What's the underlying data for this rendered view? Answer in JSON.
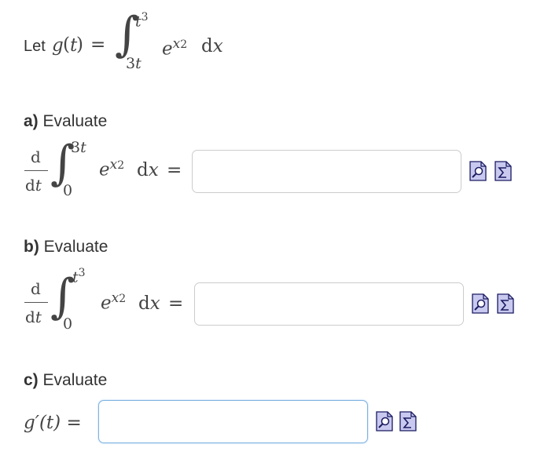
{
  "intro": {
    "let_label": "Let",
    "fn_name": "g",
    "var": "t",
    "equals": "=",
    "upper_limit": "t3",
    "lower_limit": "3t",
    "integrand_base": "e",
    "integrand_exp": "x2",
    "differential": "dx"
  },
  "parts": [
    {
      "letter": "a)",
      "prompt": "Evaluate",
      "deriv_num": "d",
      "deriv_den": "dt",
      "upper_limit": "3t",
      "lower_limit": "0",
      "integrand_base": "e",
      "integrand_exp": "x2",
      "differential": "dx",
      "equals": "=",
      "answer_value": ""
    },
    {
      "letter": "b)",
      "prompt": "Evaluate",
      "deriv_num": "d",
      "deriv_den": "dt",
      "upper_limit": "t3",
      "lower_limit": "0",
      "integrand_base": "e",
      "integrand_exp": "x2",
      "differential": "dx",
      "equals": "=",
      "answer_value": ""
    },
    {
      "letter": "c)",
      "prompt": "Evaluate",
      "lhs": "g′(t) =",
      "answer_value": ""
    }
  ],
  "icons": {
    "preview": "preview-magnifier-icon",
    "equation_editor": "equation-editor-sigma-icon"
  },
  "colors": {
    "input_border": "#cccccc",
    "input_focus_border": "#7fb3e0",
    "icon_fill": "#c9c9f0",
    "icon_stroke": "#1a1a60"
  }
}
